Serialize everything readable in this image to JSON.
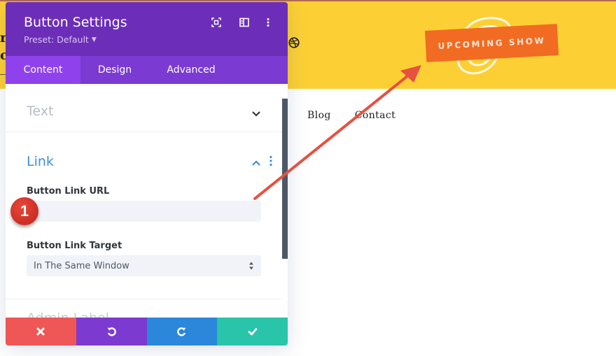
{
  "site": {
    "logo_fragment_line1": "r",
    "logo_fragment_line2": "o",
    "badge_text": "UPCOMING SHOW",
    "nav": [
      "Blog",
      "Contact"
    ],
    "colors": {
      "header_bg": "#fcd034",
      "badge_bg": "#f26b22"
    }
  },
  "modal": {
    "title": "Button Settings",
    "preset_label": "Preset: Default",
    "header_icons": [
      "focus-icon",
      "sidebar-layout-icon",
      "more-vertical-icon"
    ],
    "tabs": [
      {
        "label": "Content",
        "active": true
      },
      {
        "label": "Design",
        "active": false
      },
      {
        "label": "Advanced",
        "active": false
      }
    ],
    "sections": {
      "text": {
        "title": "Text",
        "expanded": false
      },
      "link": {
        "title": "Link",
        "expanded": true,
        "url_label": "Button Link URL",
        "url_value": "",
        "url_placeholder": "",
        "target_label": "Button Link Target",
        "target_value": "In The Same Window"
      },
      "admin_label": {
        "title": "Admin Label",
        "expanded": false
      }
    },
    "footer_buttons": [
      {
        "name": "cancel",
        "icon": "close-icon",
        "color": "#ef5656"
      },
      {
        "name": "undo",
        "icon": "undo-icon",
        "color": "#7d3ad0"
      },
      {
        "name": "redo",
        "icon": "redo-icon",
        "color": "#2b87da"
      },
      {
        "name": "save",
        "icon": "check-icon",
        "color": "#29c4a9"
      }
    ],
    "colors": {
      "header": "#6c2eb9",
      "tabs": "#7b3ad2",
      "active_tab": "#8f42ec",
      "link_accent": "#3d8fd6"
    }
  },
  "annotation": {
    "step_number": "1",
    "arrow_color": "#e8503f"
  }
}
